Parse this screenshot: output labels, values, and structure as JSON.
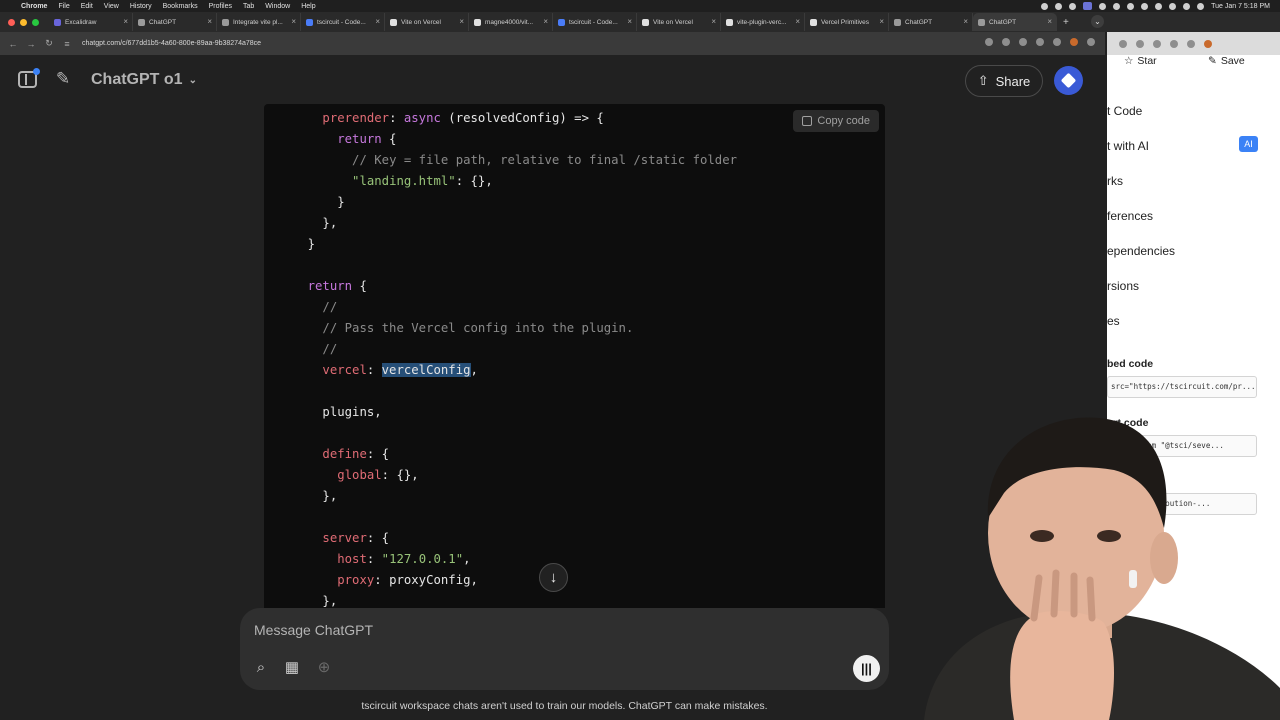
{
  "menubar": {
    "items": [
      "Chrome",
      "File",
      "Edit",
      "View",
      "History",
      "Bookmarks",
      "Profiles",
      "Tab",
      "Window",
      "Help"
    ],
    "clock": "Tue Jan 7  5:18 PM"
  },
  "tabs": [
    {
      "label": "Excalidraw",
      "color": "#6965db"
    },
    {
      "label": "ChatGPT",
      "color": "#9a9a9a"
    },
    {
      "label": "Integrate vite pl...",
      "color": "#9a9a9a"
    },
    {
      "label": "tscircuit - Code...",
      "color": "#4a7cf7"
    },
    {
      "label": "Vite on Vercel",
      "color": "#e0e0e0"
    },
    {
      "label": "magne4000/vit...",
      "color": "#e0e0e0"
    },
    {
      "label": "tscircuit - Code...",
      "color": "#4a7cf7"
    },
    {
      "label": "Vite on Vercel",
      "color": "#e0e0e0"
    },
    {
      "label": "vite-plugin-verc...",
      "color": "#e0e0e0"
    },
    {
      "label": "Vercel Primitives",
      "color": "#e0e0e0"
    },
    {
      "label": "ChatGPT",
      "color": "#9a9a9a"
    },
    {
      "label": "ChatGPT",
      "color": "#9a9a9a"
    }
  ],
  "address": {
    "url": "chatgpt.com/c/677dd1b5-4a60-800e-89aa-9b38274a78ce"
  },
  "header": {
    "model_label": "ChatGPT o1",
    "share_label": "Share"
  },
  "code": {
    "copy_label": "Copy code",
    "lines": [
      {
        "indent": "      ",
        "tokens": [
          {
            "c": "t-key",
            "t": "prerender"
          },
          {
            "c": "t-plain",
            "t": ": "
          },
          {
            "c": "t-kw",
            "t": "async"
          },
          {
            "c": "t-plain",
            "t": " (resolvedConfig) => {"
          }
        ]
      },
      {
        "indent": "        ",
        "tokens": [
          {
            "c": "t-kw",
            "t": "return"
          },
          {
            "c": "t-plain",
            "t": " {"
          }
        ]
      },
      {
        "indent": "          ",
        "tokens": [
          {
            "c": "t-com",
            "t": "// Key = file path, relative to final /static folder"
          }
        ]
      },
      {
        "indent": "          ",
        "tokens": [
          {
            "c": "t-str",
            "t": "\"landing.html\""
          },
          {
            "c": "t-plain",
            "t": ": {},"
          }
        ]
      },
      {
        "indent": "        ",
        "tokens": [
          {
            "c": "t-plain",
            "t": "}"
          }
        ]
      },
      {
        "indent": "      ",
        "tokens": [
          {
            "c": "t-plain",
            "t": "},"
          }
        ]
      },
      {
        "indent": "    ",
        "tokens": [
          {
            "c": "t-plain",
            "t": "}"
          }
        ]
      },
      {
        "indent": "",
        "tokens": []
      },
      {
        "indent": "    ",
        "tokens": [
          {
            "c": "t-kw",
            "t": "return"
          },
          {
            "c": "t-plain",
            "t": " {"
          }
        ]
      },
      {
        "indent": "      ",
        "tokens": [
          {
            "c": "t-com",
            "t": "//"
          }
        ]
      },
      {
        "indent": "      ",
        "tokens": [
          {
            "c": "t-com",
            "t": "// Pass the Vercel config into the plugin."
          }
        ]
      },
      {
        "indent": "      ",
        "tokens": [
          {
            "c": "t-com",
            "t": "//"
          }
        ]
      },
      {
        "indent": "      ",
        "tokens": [
          {
            "c": "t-key",
            "t": "vercel"
          },
          {
            "c": "t-plain",
            "t": ": "
          },
          {
            "c": "t-sel",
            "t": "vercelConfig"
          },
          {
            "c": "t-plain",
            "t": ","
          }
        ]
      },
      {
        "indent": "",
        "tokens": []
      },
      {
        "indent": "      ",
        "tokens": [
          {
            "c": "t-plain",
            "t": "plugins,"
          }
        ]
      },
      {
        "indent": "",
        "tokens": []
      },
      {
        "indent": "      ",
        "tokens": [
          {
            "c": "t-key",
            "t": "define"
          },
          {
            "c": "t-plain",
            "t": ": {"
          }
        ]
      },
      {
        "indent": "        ",
        "tokens": [
          {
            "c": "t-key",
            "t": "global"
          },
          {
            "c": "t-plain",
            "t": ": {},"
          }
        ]
      },
      {
        "indent": "      ",
        "tokens": [
          {
            "c": "t-plain",
            "t": "},"
          }
        ]
      },
      {
        "indent": "",
        "tokens": []
      },
      {
        "indent": "      ",
        "tokens": [
          {
            "c": "t-key",
            "t": "server"
          },
          {
            "c": "t-plain",
            "t": ": {"
          }
        ]
      },
      {
        "indent": "        ",
        "tokens": [
          {
            "c": "t-key",
            "t": "host"
          },
          {
            "c": "t-plain",
            "t": ": "
          },
          {
            "c": "t-str",
            "t": "\"127.0.0.1\""
          },
          {
            "c": "t-plain",
            "t": ","
          }
        ]
      },
      {
        "indent": "        ",
        "tokens": [
          {
            "c": "t-key",
            "t": "proxy"
          },
          {
            "c": "t-plain",
            "t": ": proxyConfig,"
          }
        ]
      },
      {
        "indent": "      ",
        "tokens": [
          {
            "c": "t-plain",
            "t": "},"
          }
        ]
      }
    ]
  },
  "composer": {
    "placeholder": "Message ChatGPT"
  },
  "disclaimer": "tscircuit workspace chats aren't used to train our models. ChatGPT can make mistakes.",
  "right_panel": {
    "star_label": "Star",
    "save_label": "Save",
    "items": [
      "t Code",
      "t with AI",
      "rks",
      "ferences",
      "ependencies",
      "rsions",
      "es"
    ],
    "ai_badge": "AI",
    "section1": "bed code",
    "box1": "src=\"https://tscircuit.com/pr...",
    "section2": "ort code",
    "box2": "odule from \"@tsci/seve...",
    "section3": "and",
    "box3": "eibar.contribution-..."
  }
}
